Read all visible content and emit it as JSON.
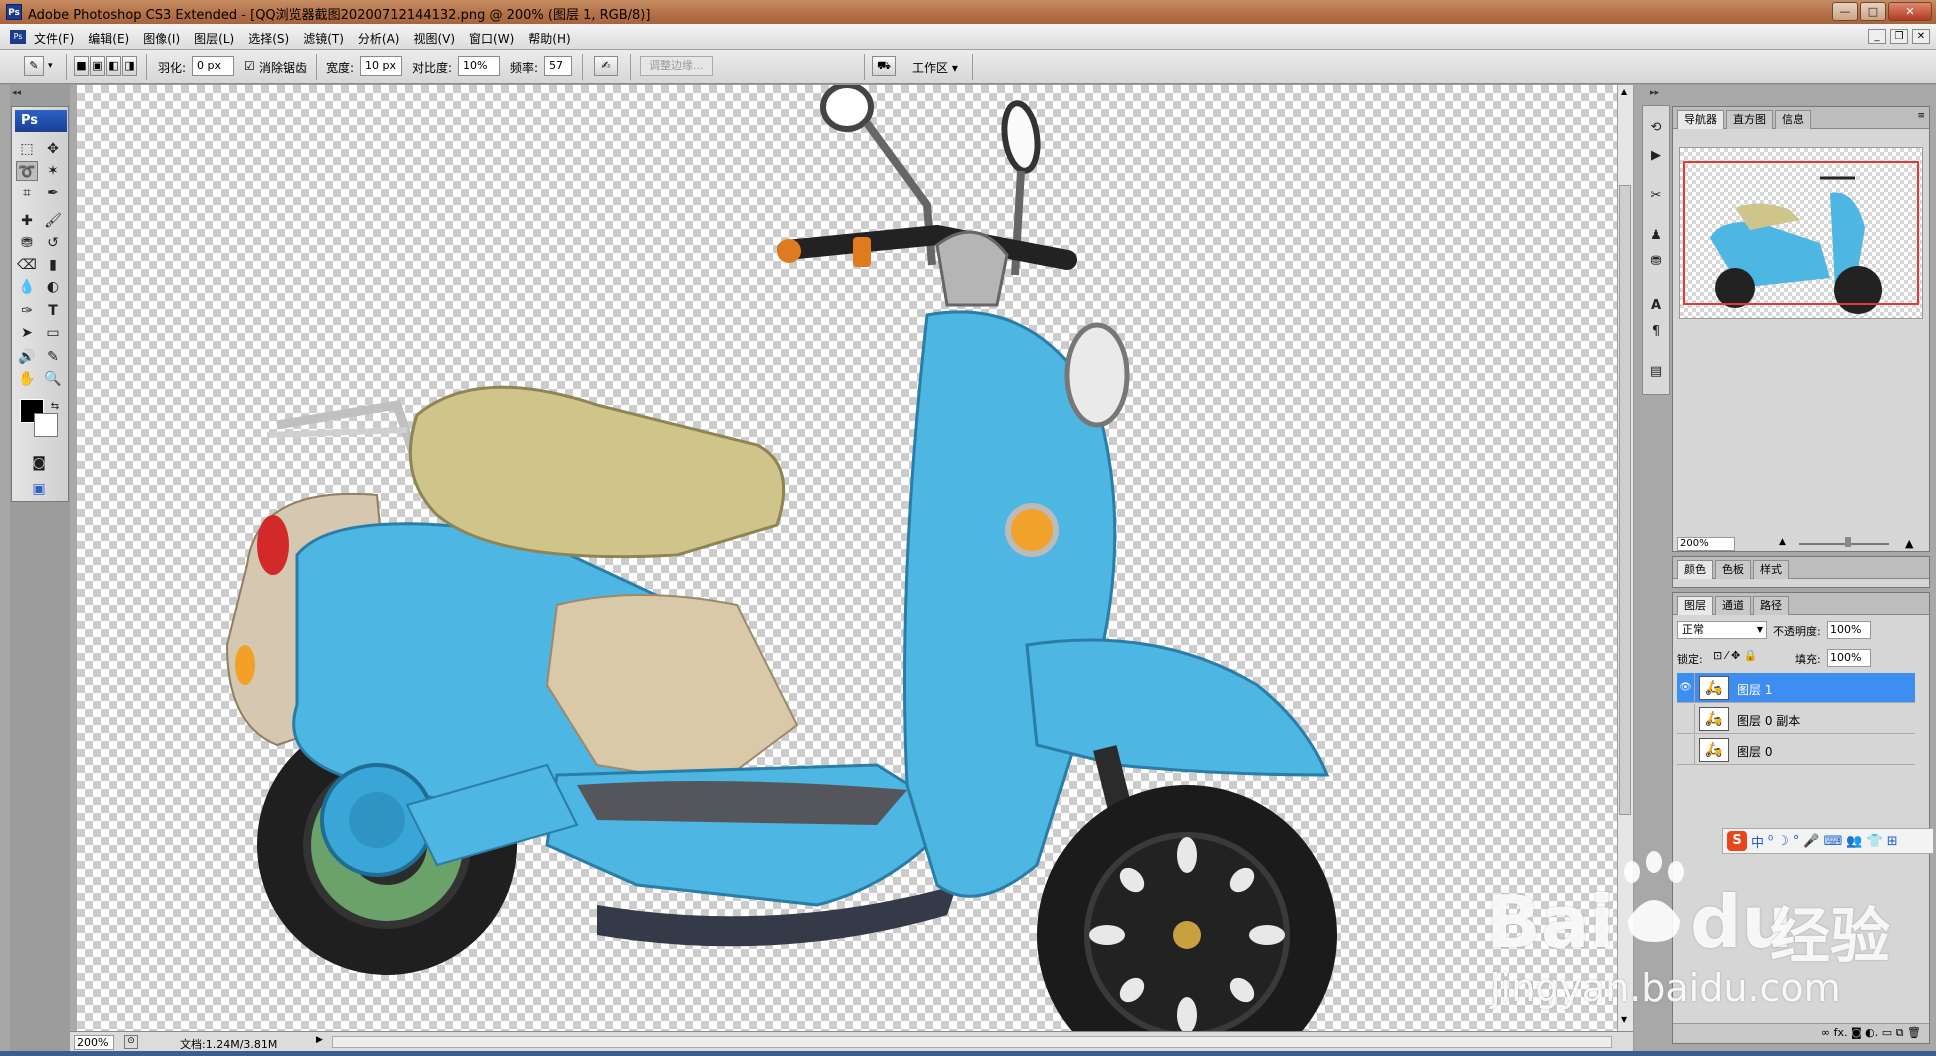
{
  "window": {
    "title": "Adobe Photoshop CS3 Extended - [QQ浏览器截图20200712144132.png @ 200% (图层 1, RGB/8)]",
    "app_icon": "Ps",
    "controls": [
      "minimize",
      "maximize",
      "close"
    ]
  },
  "menubar": {
    "items": [
      "文件(F)",
      "编辑(E)",
      "图像(I)",
      "图层(L)",
      "选择(S)",
      "滤镜(T)",
      "分析(A)",
      "视图(V)",
      "窗口(W)",
      "帮助(H)"
    ]
  },
  "options": {
    "feather_label": "羽化:",
    "feather_value": "0 px",
    "antialias_label": "消除锯齿",
    "antialias_checked": true,
    "width_label": "宽度:",
    "width_value": "10 px",
    "contrast_label": "对比度:",
    "contrast_value": "10%",
    "frequency_label": "频率:",
    "frequency_value": "57",
    "refine_edge": "调整边缘...",
    "workspace": "工作区 ▾"
  },
  "toolbox": {
    "logo": "Ps",
    "active_tool": "magnetic-lasso",
    "foreground_color": "#000000",
    "background_color": "#ffffff"
  },
  "statusbar": {
    "zoom": "200%",
    "doc_info": "文档:1.24M/3.81M"
  },
  "navigator": {
    "tabs": [
      "导航器",
      "直方图",
      "信息"
    ],
    "active_tab": "导航器",
    "zoom": "200%"
  },
  "color_panel": {
    "tabs": [
      "颜色",
      "色板",
      "样式"
    ]
  },
  "layers_panel": {
    "tabs": [
      "图层",
      "通道",
      "路径"
    ],
    "blend_mode": "正常",
    "opacity_label": "不透明度:",
    "opacity_value": "100%",
    "lock_label": "锁定:",
    "fill_label": "填充:",
    "fill_value": "100%",
    "layers": [
      {
        "name": "图层 1",
        "visible": true,
        "selected": true
      },
      {
        "name": "图层 0 副本",
        "visible": false,
        "selected": false
      },
      {
        "name": "图层 0",
        "visible": false,
        "selected": false
      }
    ]
  },
  "ime_bar": {
    "items": [
      "S",
      "中",
      "⁰",
      "☽",
      "°",
      "🎤",
      "⌨",
      "👥",
      "👕",
      "⊞"
    ]
  },
  "watermark": {
    "brand": "Bai",
    "paw": "du",
    "suffix": "经验",
    "url": "jingyan.baidu.com"
  },
  "colors": {
    "accent": "#3d8ef0",
    "scooter_body": "#4db6e2",
    "scooter_seat": "#cfc58b",
    "scooter_panel": "#d9c9a8",
    "nav_frame": "#e53935"
  }
}
